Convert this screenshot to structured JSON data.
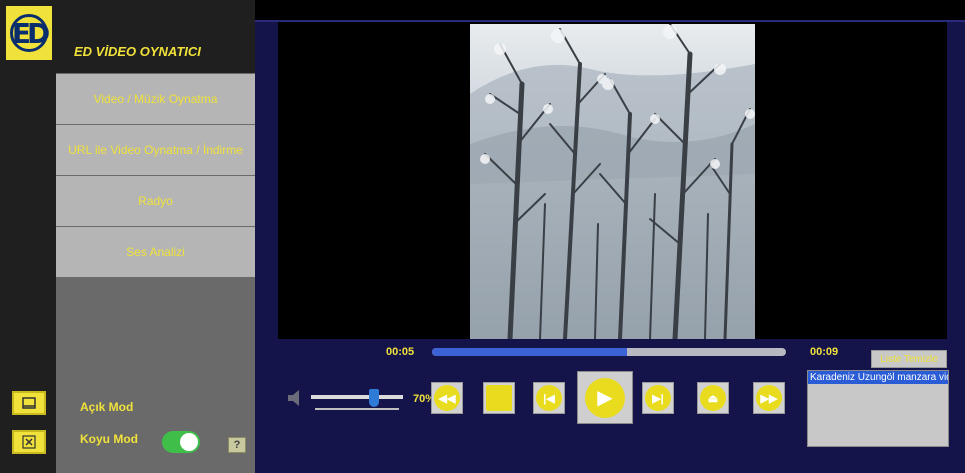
{
  "app": {
    "logo_text": "ED",
    "title": "ED VİDEO OYNATICI"
  },
  "window_controls": {
    "minimize_icon": "minimize-icon",
    "close_icon": "close-icon"
  },
  "menu": {
    "items": [
      {
        "label": "Video / Müzik Oynatma"
      },
      {
        "label": "URL ile Video Oynatma / İndirme"
      },
      {
        "label": "Radyo"
      },
      {
        "label": "Ses Analizi"
      }
    ]
  },
  "modes": {
    "light_label": "Açık Mod",
    "dark_label": "Koyu Mod",
    "dark_enabled": true,
    "help_label": "?"
  },
  "player": {
    "current_time": "00:05",
    "total_time": "00:09",
    "progress_percent": 55,
    "volume_percent": 70,
    "volume_label": "70%"
  },
  "controls": [
    {
      "name": "rewind-button",
      "icon": "rewind-icon",
      "glyph": "◀◀"
    },
    {
      "name": "stop-button",
      "icon": "stop-icon",
      "glyph": ""
    },
    {
      "name": "previous-button",
      "icon": "skip-previous-icon",
      "glyph": "|◀"
    },
    {
      "name": "next-button",
      "icon": "skip-next-icon",
      "glyph": "▶|"
    },
    {
      "name": "eject-button",
      "icon": "eject-icon",
      "glyph": "⏏"
    },
    {
      "name": "fast-forward-button",
      "icon": "fast-forward-icon",
      "glyph": "▶▶"
    }
  ],
  "playlist": {
    "clear_label": "Liste Temizle",
    "items": [
      "Karadeniz Uzungöl manzara video"
    ]
  },
  "colors": {
    "accent": "#f0e23a",
    "panel": "#14144a",
    "progress": "#3c63d6"
  }
}
